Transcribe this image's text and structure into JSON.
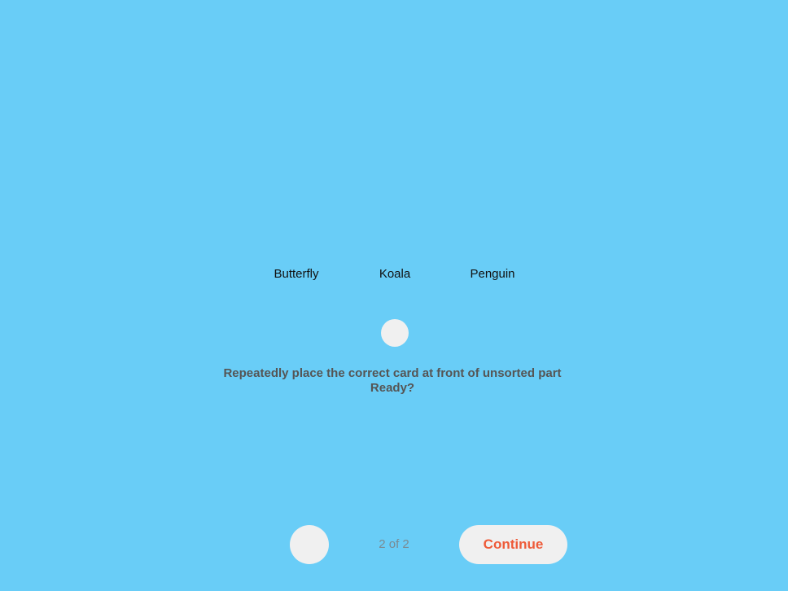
{
  "cards": {
    "items": [
      {
        "label": "Butterfly"
      },
      {
        "label": "Koala"
      },
      {
        "label": "Penguin"
      }
    ]
  },
  "instruction": {
    "line1": "Repeatedly place the correct card at front of unsorted part",
    "line2": "Ready?"
  },
  "navigation": {
    "page_indicator": "2 of 2",
    "continue_label": "Continue"
  },
  "colors": {
    "background": "#69cdf7",
    "button_bg": "#f0f0f0",
    "accent": "#ee5a38",
    "instruction_text": "#555555"
  }
}
